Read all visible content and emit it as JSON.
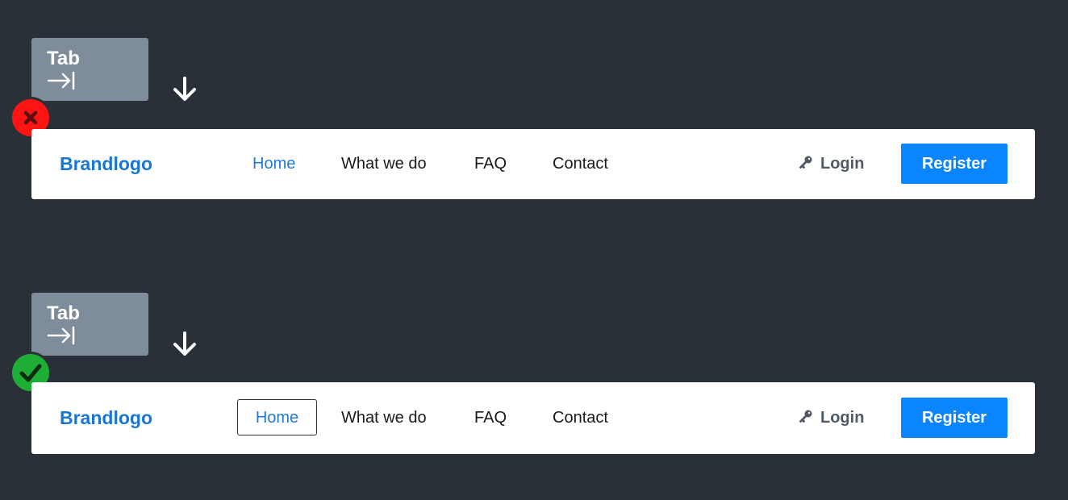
{
  "colors": {
    "background": "#2a3038",
    "key": "#7e8c9b",
    "brand": "#1976d2",
    "active_link": "#1f7ad6",
    "register_button": "#0b84ff",
    "fail_badge": "#ff1414",
    "pass_badge": "#1fae35"
  },
  "examples": [
    {
      "status": "fail",
      "status_icon": "x-icon",
      "key": {
        "label": "Tab",
        "icon": "tab-arrow-icon"
      },
      "arrow_icon": "arrow-down-icon",
      "focus_outline_visible": false,
      "nav": {
        "brand": "Brandlogo",
        "links": [
          "Home",
          "What we do",
          "FAQ",
          "Contact"
        ],
        "active_link": "Home",
        "login": {
          "label": "Login",
          "icon": "key-icon"
        },
        "register": "Register"
      }
    },
    {
      "status": "pass",
      "status_icon": "check-icon",
      "key": {
        "label": "Tab",
        "icon": "tab-arrow-icon"
      },
      "arrow_icon": "arrow-down-icon",
      "focus_outline_visible": true,
      "nav": {
        "brand": "Brandlogo",
        "links": [
          "Home",
          "What we do",
          "FAQ",
          "Contact"
        ],
        "active_link": "Home",
        "login": {
          "label": "Login",
          "icon": "key-icon"
        },
        "register": "Register"
      }
    }
  ]
}
